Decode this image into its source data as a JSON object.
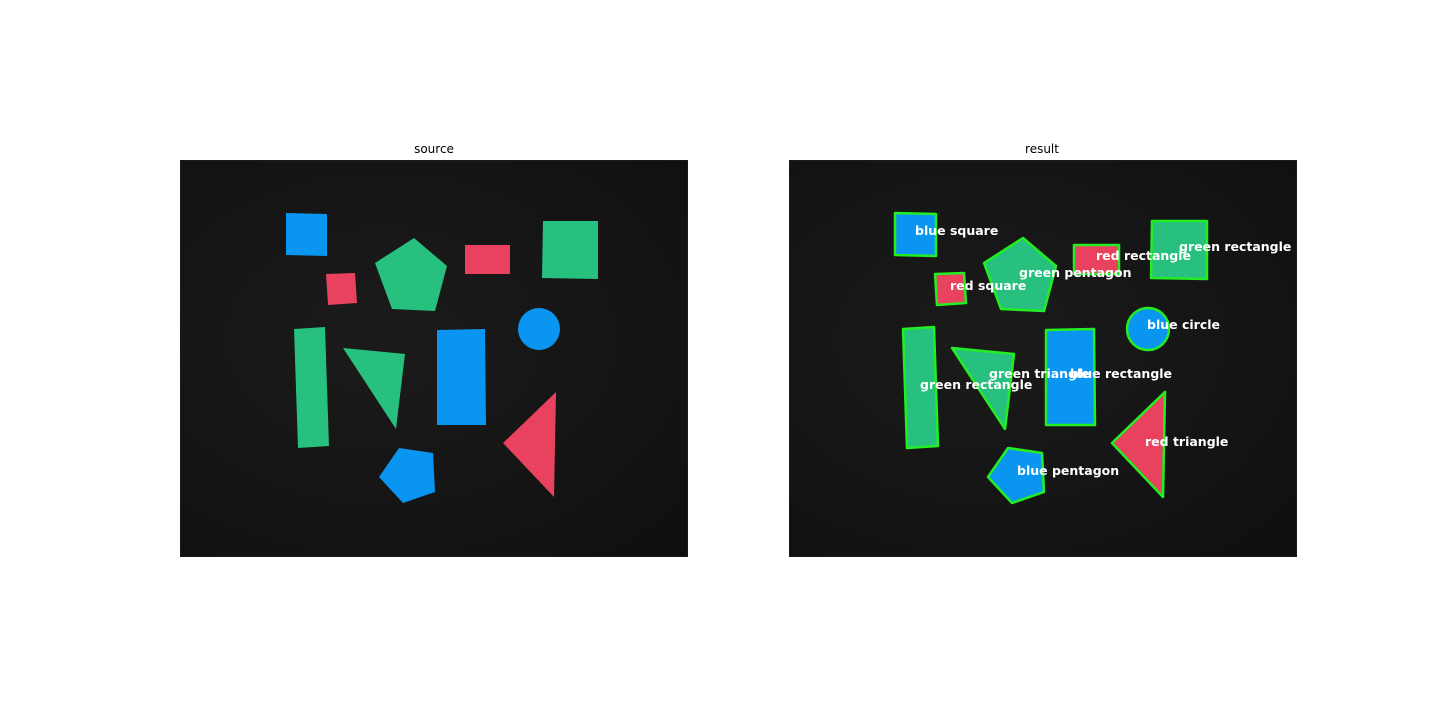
{
  "figure": {
    "left_title": "source",
    "right_title": "result"
  },
  "colors": {
    "background": "#141414",
    "blue": "#0a96f0",
    "green": "#27c07e",
    "red": "#e8425e",
    "outline": "#22ee22",
    "label": "#ffffff"
  },
  "shapes": [
    {
      "id": "s1",
      "color": "blue",
      "type": "square"
    },
    {
      "id": "s2",
      "color": "red",
      "type": "square"
    },
    {
      "id": "s3",
      "color": "green",
      "type": "pentagon"
    },
    {
      "id": "s4",
      "color": "red",
      "type": "rectangle"
    },
    {
      "id": "s5",
      "color": "green",
      "type": "rectangle"
    },
    {
      "id": "s6",
      "color": "blue",
      "type": "circle"
    },
    {
      "id": "s7",
      "color": "green",
      "type": "rectangle"
    },
    {
      "id": "s8",
      "color": "green",
      "type": "triangle"
    },
    {
      "id": "s9",
      "color": "blue",
      "type": "rectangle"
    },
    {
      "id": "s10",
      "color": "red",
      "type": "triangle"
    },
    {
      "id": "s11",
      "color": "blue",
      "type": "pentagon"
    }
  ],
  "labels": {
    "blue_square": "blue square",
    "red_square": "red square",
    "green_pentagon": "green pentagon",
    "red_rectangle": "red rectangle",
    "green_rectangle_top": "green rectangle",
    "blue_circle": "blue circle",
    "green_rectangle_left": "green rectangle",
    "green_triangle": "green triangle",
    "blue_rectangle": "blue rectangle",
    "red_triangle": "red triangle",
    "blue_pentagon": "blue pentagon"
  }
}
